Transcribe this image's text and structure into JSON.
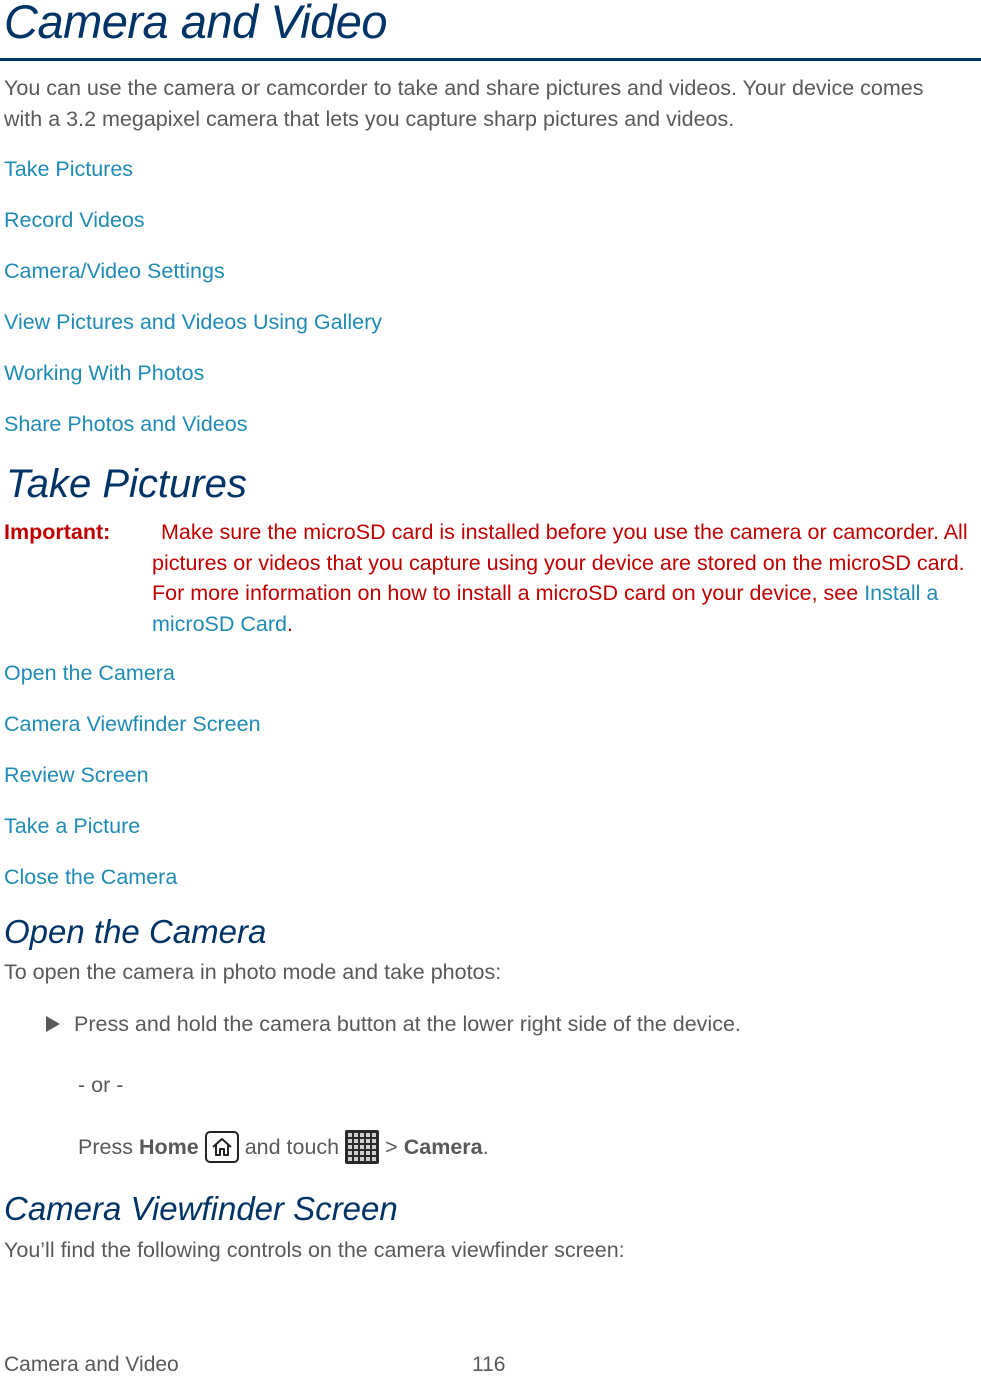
{
  "page": {
    "title": "Camera and Video",
    "intro": "You can use the camera or camcorder to take and share pictures and videos. Your device comes with a 3.2 megapixel camera that lets you capture sharp pictures and videos.",
    "toc": [
      "Take Pictures",
      "Record Videos",
      "Camera/Video Settings",
      "View Pictures and Videos Using Gallery",
      "Working With Photos",
      "Share Photos and Videos"
    ],
    "colors": {
      "heading": "#003366",
      "link": "#1f8bb5",
      "important": "#c00000",
      "body": "#595959"
    }
  },
  "take_pictures": {
    "heading": "Take Pictures",
    "important": {
      "label": "Important:",
      "text": "Make sure the microSD card is installed before you use the camera or camcorder. All pictures or videos that you capture using your device are stored on the microSD card. For more information on how to install a microSD card on your device, see ",
      "link": "Install a microSD Card",
      "suffix": "."
    },
    "toc": [
      "Open the Camera",
      "Camera Viewfinder Screen",
      "Review Screen",
      "Take a Picture",
      "Close the Camera"
    ]
  },
  "open_camera": {
    "heading": "Open the Camera",
    "intro": "To open the camera in photo mode and take photos:",
    "bullet": "Press and hold the camera button at the lower right side of the device.",
    "or": "- or -",
    "press": "Press",
    "home": "Home",
    "and_touch": "and touch",
    "gt": ">",
    "camera": "Camera",
    "period": ".",
    "home_icon": "home-icon",
    "apps_icon": "apps-grid-icon"
  },
  "viewfinder": {
    "heading": "Camera Viewfinder Screen",
    "intro": "You’ll find the following controls on the camera viewfinder screen:"
  },
  "footer": {
    "section": "Camera and Video",
    "page_number": "116"
  }
}
